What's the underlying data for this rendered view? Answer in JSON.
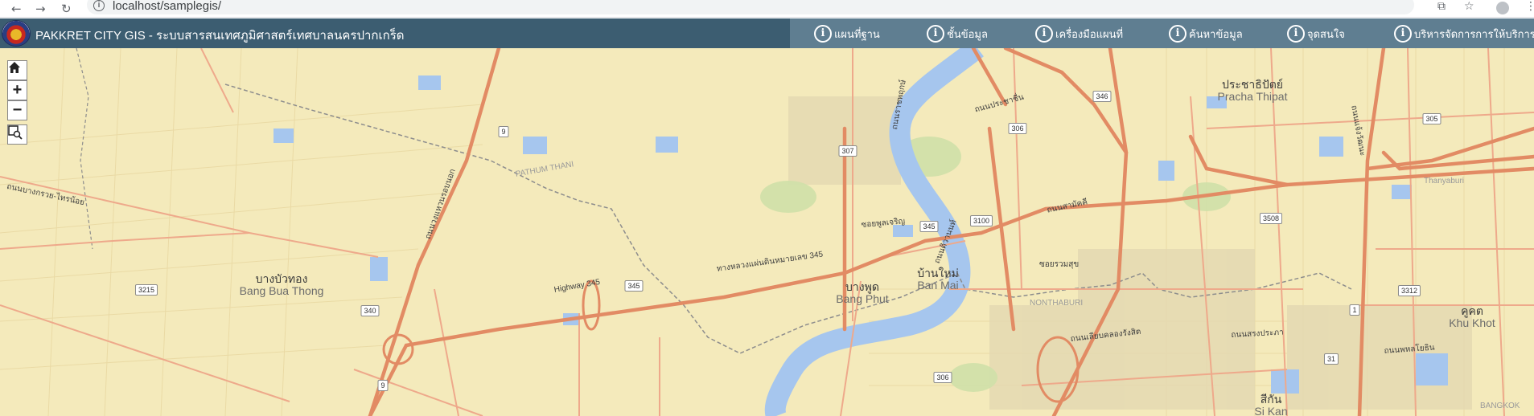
{
  "browser": {
    "url": "localhost/samplegis/"
  },
  "header": {
    "title": "PAKKRET CITY GIS - ระบบสารสนเทศภูมิศาสตร์เทศบาลนครปากเกร็ด",
    "menu": [
      {
        "label": "แผนที่ฐาน",
        "icon": "info-icon"
      },
      {
        "label": "ชั้นข้อมูล",
        "icon": "info-icon"
      },
      {
        "label": "เครื่องมือแผนที่",
        "icon": "info-icon"
      },
      {
        "label": "ค้นหาข้อมูล",
        "icon": "info-icon"
      },
      {
        "label": "จุดสนใจ",
        "icon": "info-icon"
      },
      {
        "label": "บริหารจัดการการให้บริการ",
        "icon": "info-icon"
      }
    ]
  },
  "map_controls": {
    "home_icon": "home-icon",
    "zoom_in": "+",
    "zoom_out": "−",
    "zoom_box_icon": "zoom-box-icon"
  },
  "colors": {
    "header_bg": "#3c5d71",
    "header_menu_bg": "#5f7e91",
    "map_land": "#f4eabb",
    "water": "#a6c6ee",
    "major_road": "#e28b64",
    "minor_road": "#eea98b"
  },
  "places": [
    {
      "th": "บางบัวทอง",
      "en": "Bang Bua Thong"
    },
    {
      "th": "บางพูด",
      "en": "Bang Phut"
    },
    {
      "th": "บ้านใหม่",
      "en": "Ban Mai"
    },
    {
      "th": "ประชาธิปัตย์",
      "en": "Pracha Thipat"
    },
    {
      "th": "คูคต",
      "en": "Khu Khot"
    },
    {
      "th": "สีกัน",
      "en": "Si Kan"
    }
  ],
  "road_labels": [
    {
      "text": "ทางหลวงแผ่นดินหมายเลข 345"
    },
    {
      "text": "Highway 345"
    },
    {
      "text": "ถนนแจ้งวัฒนะ"
    },
    {
      "text": "ถนนติวานนท์"
    },
    {
      "text": "ถนนสามัคคี"
    },
    {
      "text": "ถนนเลียบคลองรังสิต"
    },
    {
      "text": "ถนนบางกรวย-ไทรน้อย"
    },
    {
      "text": "ถนนวงแหวนรอบนอก"
    },
    {
      "text": "ถนนราชพฤกษ์"
    },
    {
      "text": "ถนนประชาชื่น"
    },
    {
      "text": "ถนนสรงประภา"
    },
    {
      "text": "ถนนพหลโยธิน"
    }
  ],
  "route_shields": [
    "9",
    "307",
    "306",
    "345",
    "3100",
    "3215",
    "340",
    "345",
    "3508",
    "3312",
    "306",
    "346",
    "305",
    "1",
    "31",
    "9"
  ],
  "misc_labels": [
    "PATHUM THANI",
    "NONTHABURI",
    "Thanyaburi",
    "BANGKOK",
    "ซอยพูลเจริญ",
    "ซอยรวมสุข"
  ]
}
